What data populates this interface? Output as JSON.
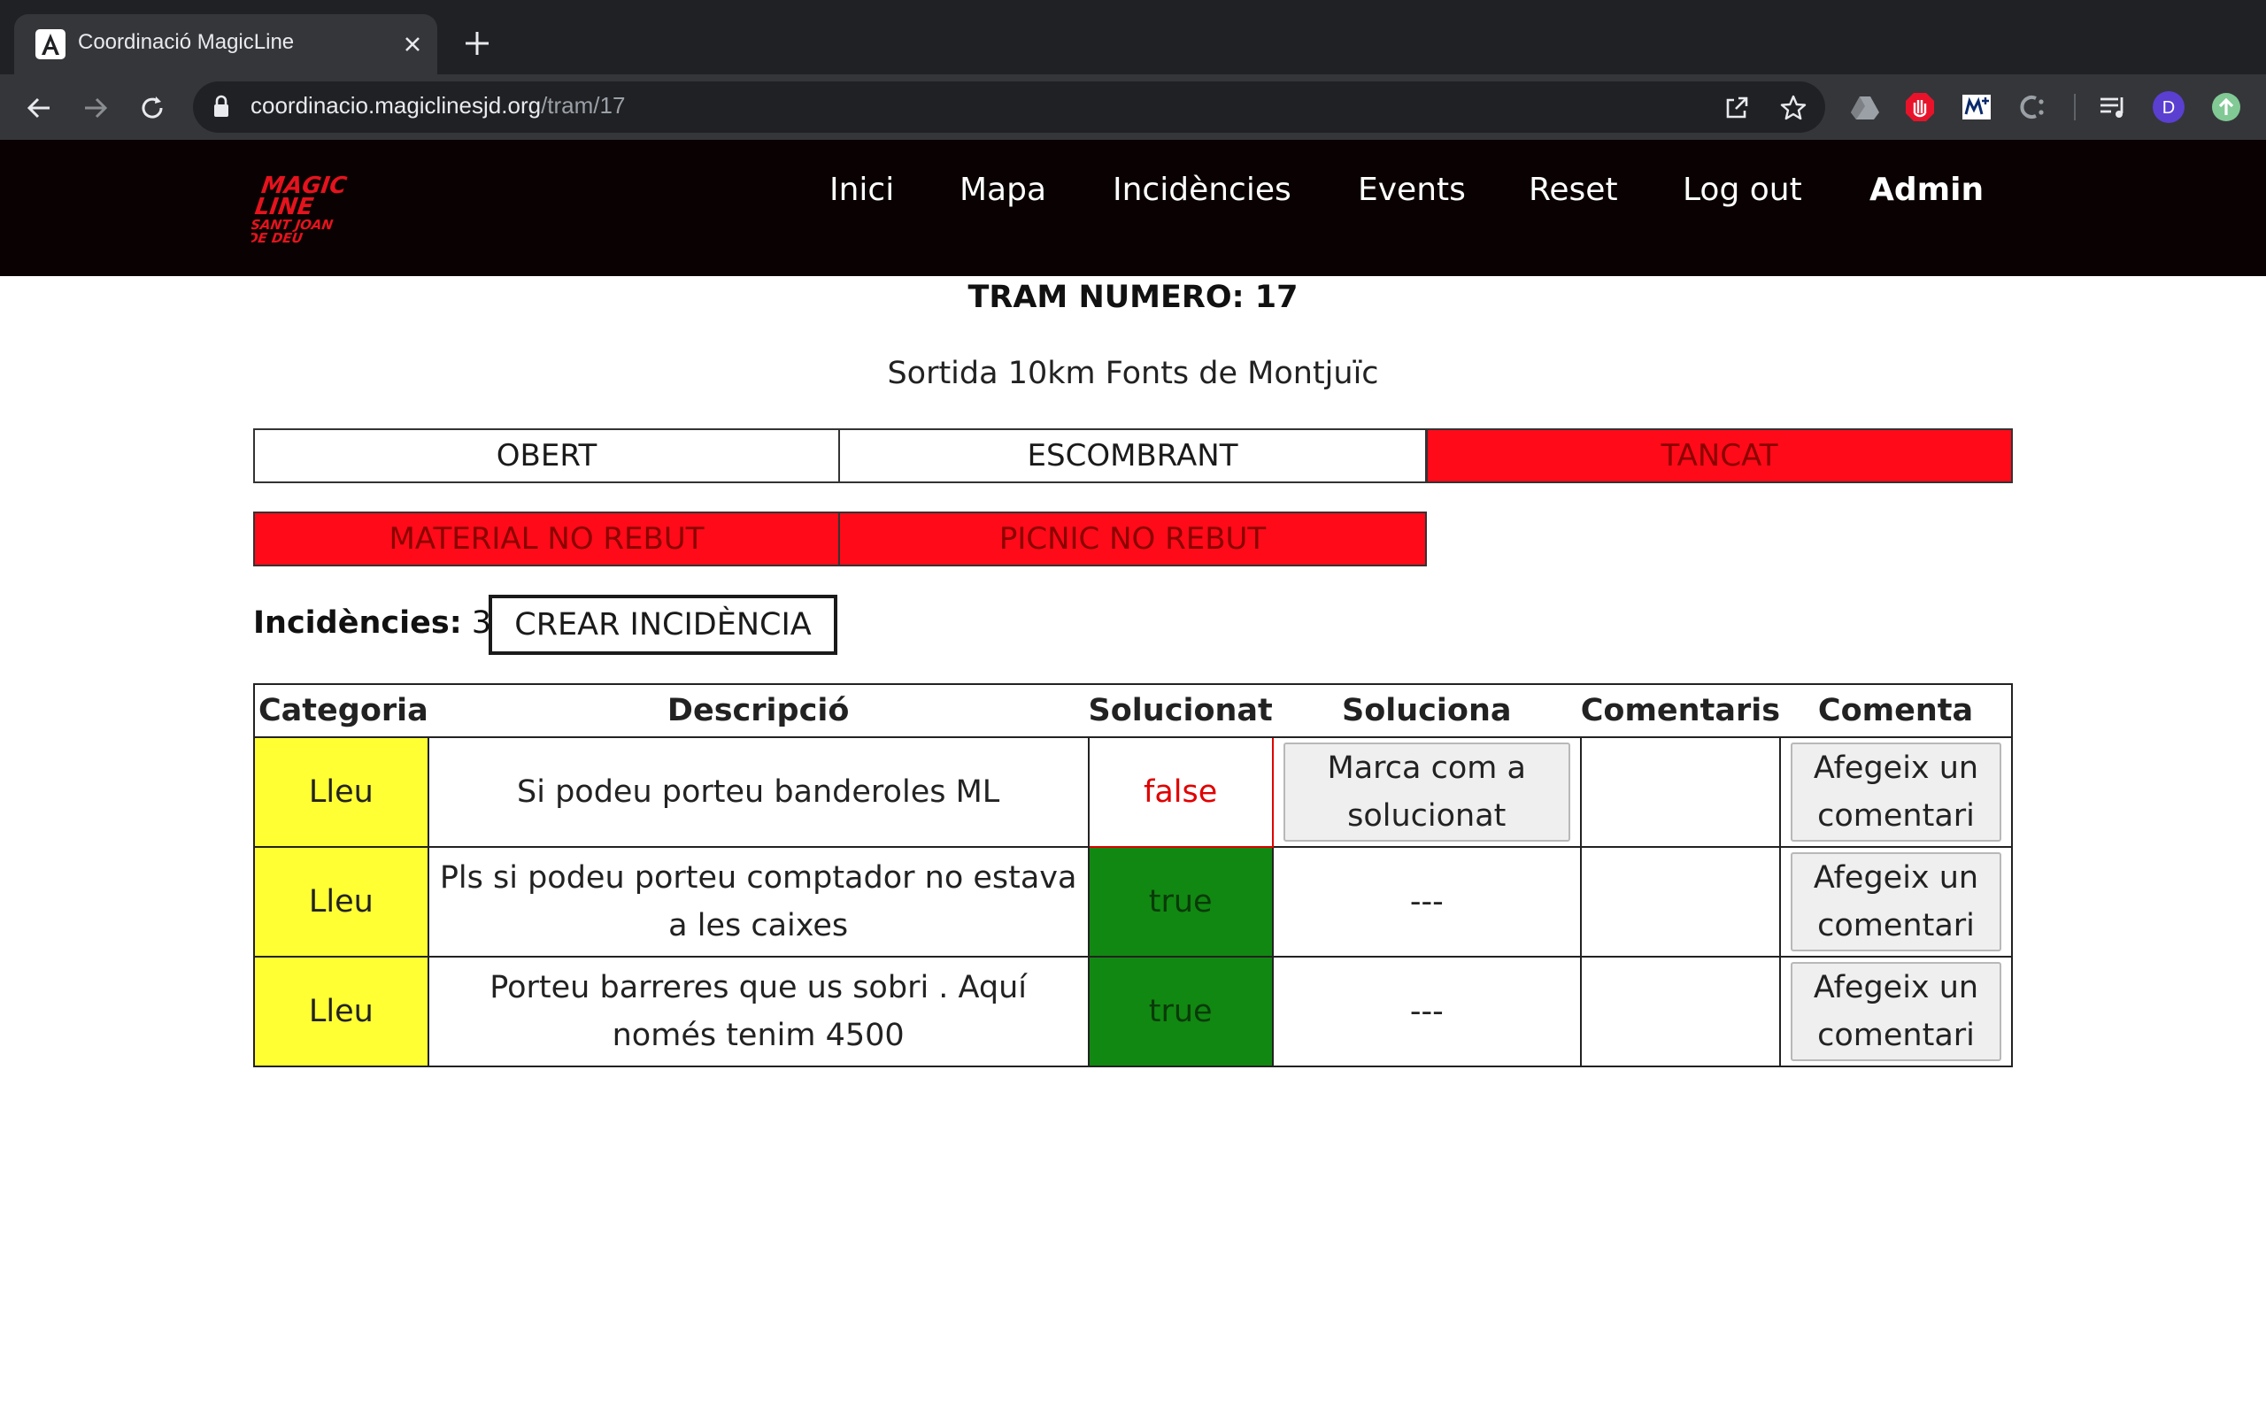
{
  "browser": {
    "tab_title": "Coordinació MagicLine",
    "url_host": "coordinacio.magiclinesjd.org",
    "url_path": "/tram/17",
    "profile_initial": "D"
  },
  "site": {
    "logo_text": "MAGIC LINE SANT JOAN DE DEU",
    "nav": [
      "Inici",
      "Mapa",
      "Incidències",
      "Events",
      "Reset",
      "Log out",
      "Admin"
    ]
  },
  "page": {
    "title": "TRAM NUMERO: 17",
    "subtitle": "Sortida 10km Fonts de Montjuïc",
    "status_buttons": [
      "OBERT",
      "ESCOMBRANT",
      "TANCAT"
    ],
    "active_status": "TANCAT",
    "material_buttons": [
      "MATERIAL NO REBUT",
      "PICNIC NO REBUT"
    ],
    "incidencies_label": "Incidències:",
    "incidencies_count": "3",
    "create_button": "CREAR INCIDÈNCIA"
  },
  "table": {
    "headers": [
      "Categoria",
      "Descripció",
      "Solucionat",
      "Soluciona",
      "Comentaris",
      "Comenta"
    ],
    "rows": [
      {
        "categoria": "Lleu",
        "descripcio": "Si podeu porteu banderoles ML",
        "solucionat": "false",
        "soluciona": "Marca com a solucionat",
        "comentaris": "",
        "comenta": "Afegeix un comentari"
      },
      {
        "categoria": "Lleu",
        "descripcio": "Pls si podeu porteu comptador no estava a les caixes",
        "solucionat": "true",
        "soluciona": "---",
        "comentaris": "",
        "comenta": "Afegeix un comentari"
      },
      {
        "categoria": "Lleu",
        "descripcio": "Porteu barreres que us sobri . Aquí només tenim 4500",
        "solucionat": "true",
        "soluciona": "---",
        "comentaris": "",
        "comenta": "Afegeix un comentari"
      }
    ]
  },
  "colors": {
    "category_lleu": "#ffff33",
    "solved_true": "#118811",
    "solved_false_text": "#e00000",
    "status_active": "#ff0a19",
    "header_bg": "#0a0202",
    "logo_red": "#e5131d"
  }
}
